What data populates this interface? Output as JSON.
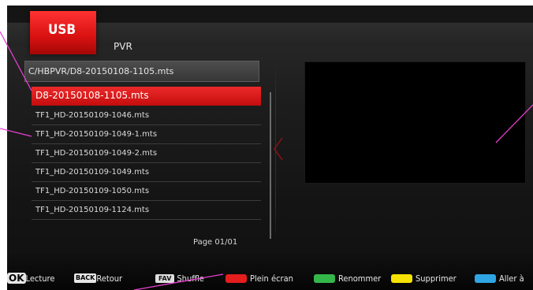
{
  "header": {
    "usb_tab": "USB",
    "pvr_label": "PVR"
  },
  "path": "C/HBPVR/D8-20150108-1105.mts",
  "files": [
    "D8-20150108-1105.mts",
    "TF1_HD-20150109-1046.mts",
    "TF1_HD-20150109-1049-1.mts",
    "TF1_HD-20150109-1049-2.mts",
    "TF1_HD-20150109-1049.mts",
    "TF1_HD-20150109-1050.mts",
    "TF1_HD-20150109-1124.mts"
  ],
  "selected_index": 0,
  "page_label": "Page  01/01",
  "footer": {
    "ok_key": "OK",
    "ok_label": "Lecture",
    "back_key": "BACK",
    "back_label": "Retour",
    "fav_key": "FAV",
    "fav_label": "Shuffle",
    "red_label": "Plein écran",
    "green_label": "Renommer",
    "yellow_label": "Supprimer",
    "blue_label": "Aller à"
  },
  "colors": {
    "accent_red": "#e01a1a",
    "btn_red": "#e41d1d",
    "btn_green": "#34b64a",
    "btn_yellow": "#f6e200",
    "btn_blue": "#2ea6e4",
    "annotation_pink": "#e83fd0"
  }
}
